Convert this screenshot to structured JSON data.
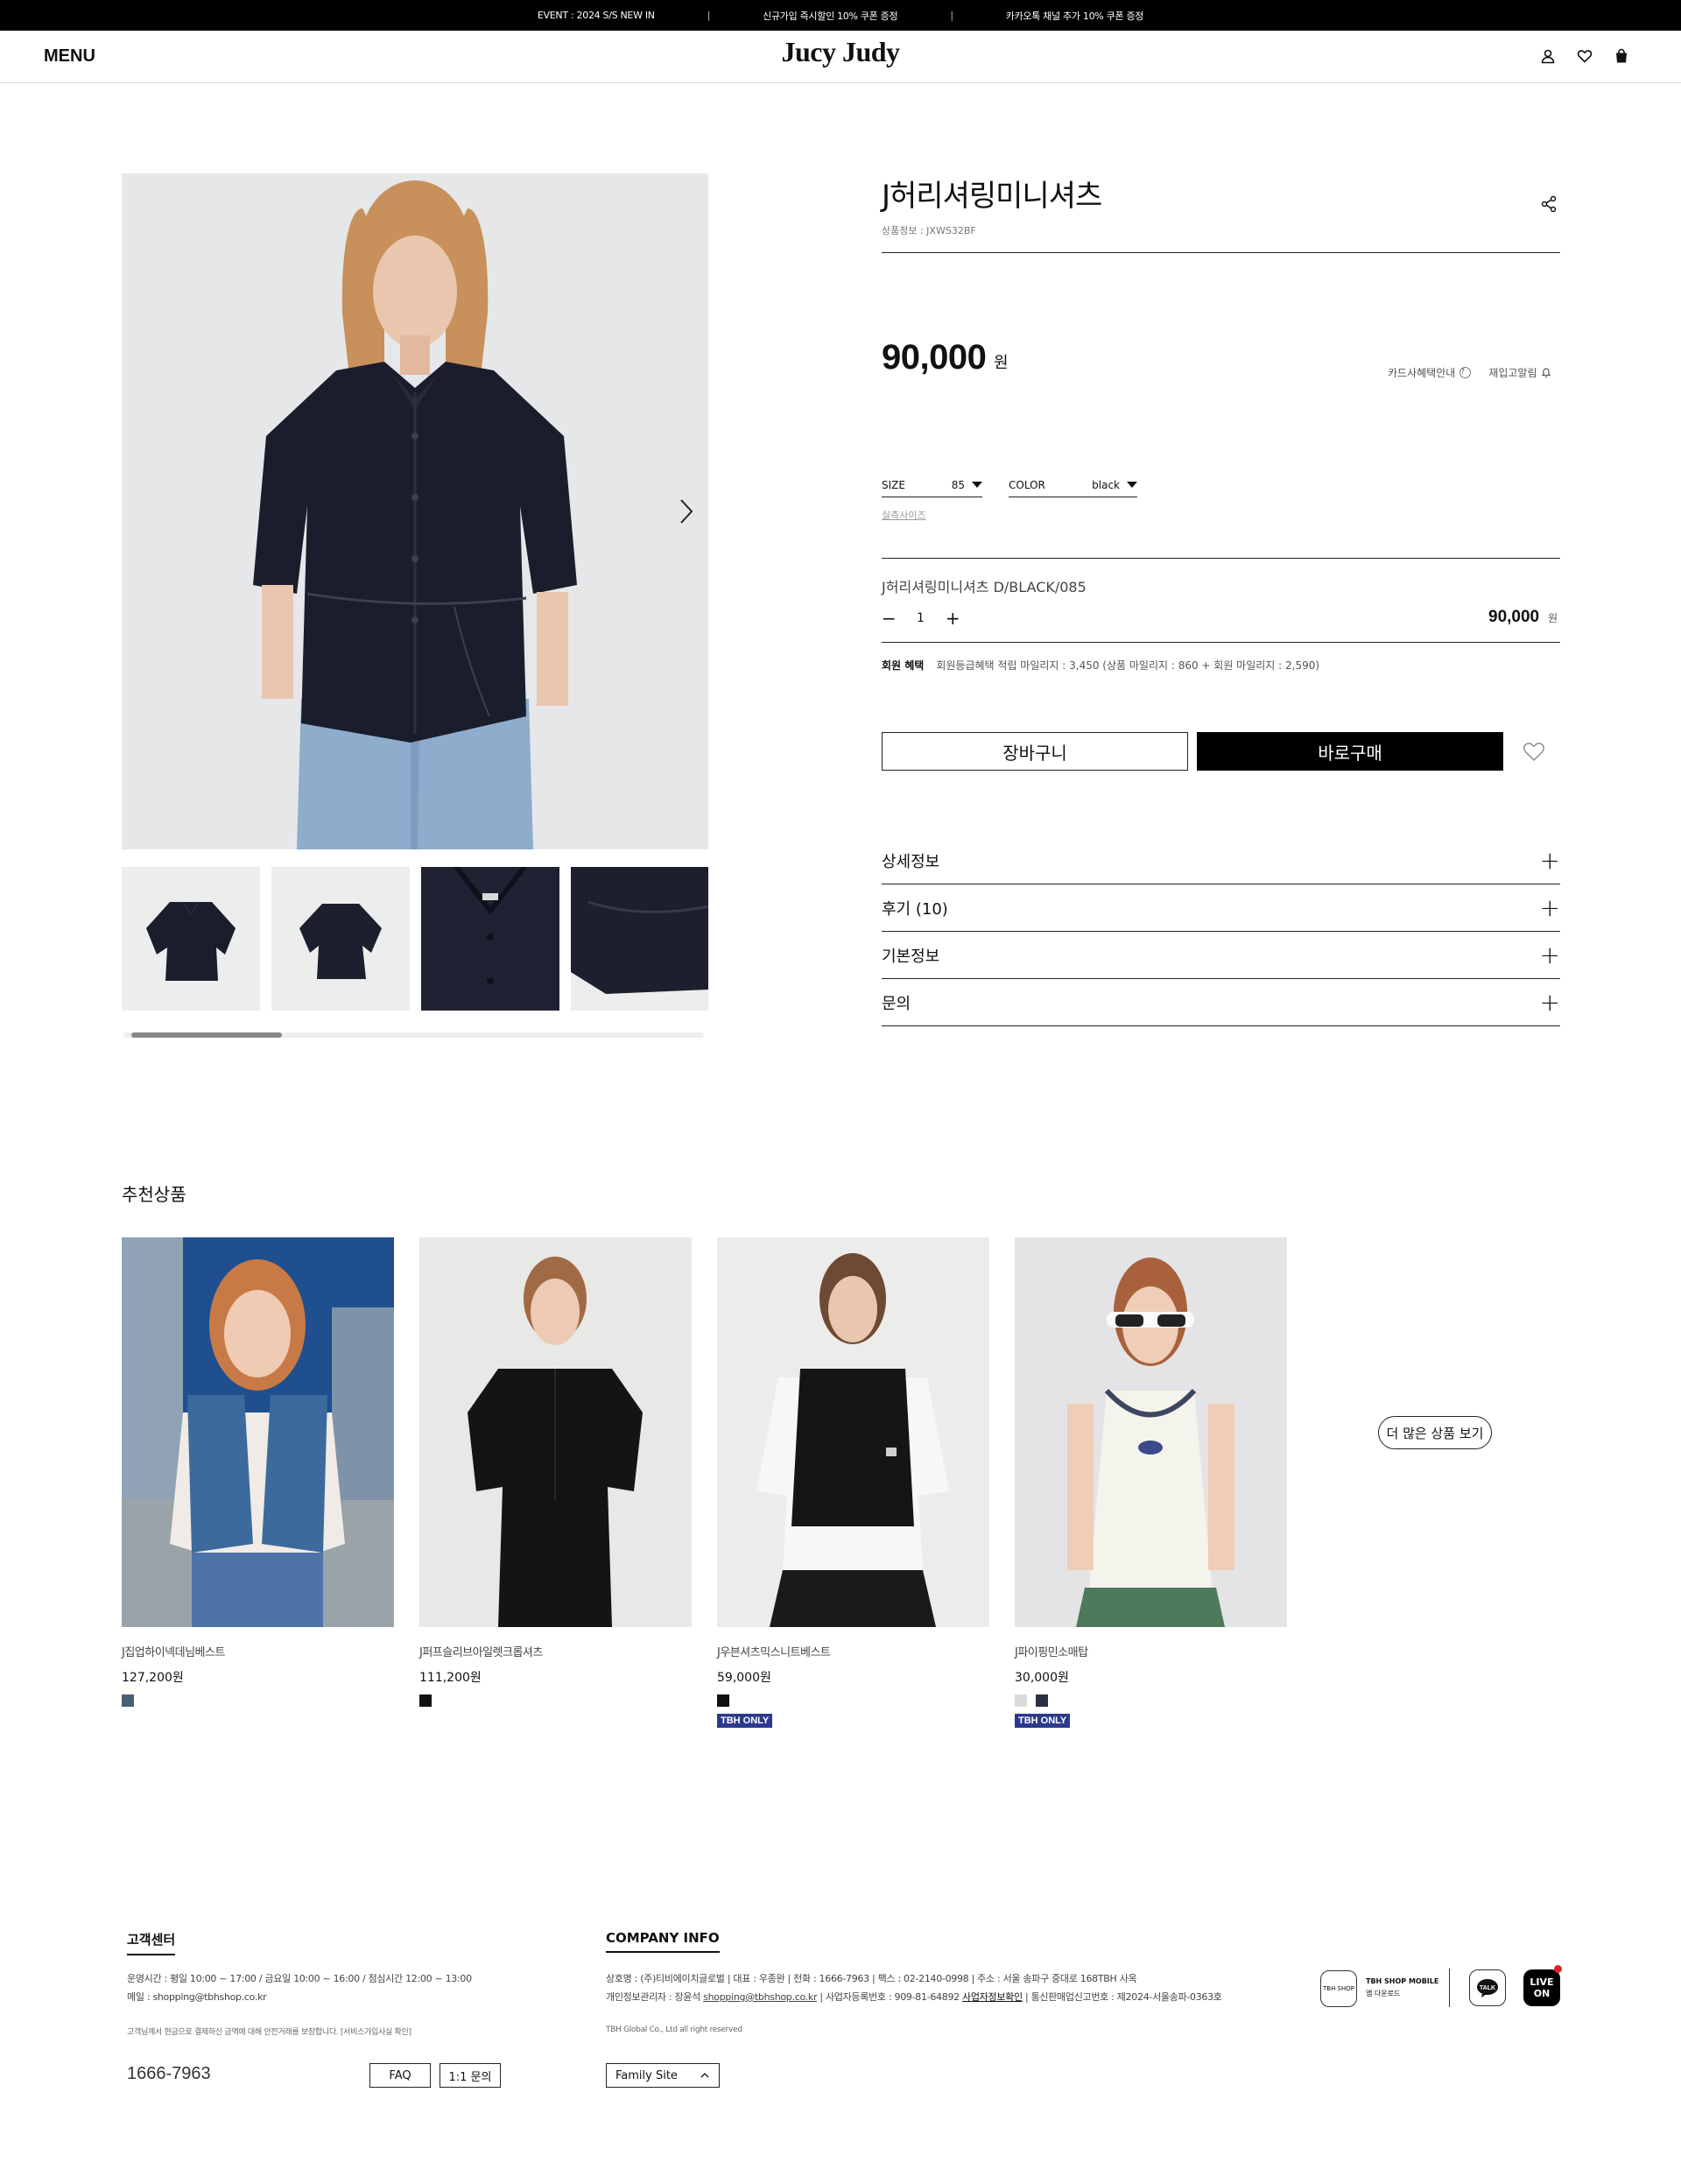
{
  "topbar": {
    "items": [
      "EVENT : 2024 S/S NEW IN",
      "신규가입 즉시할인 10% 쿠폰 증정",
      "카카오톡 채널 추가 10% 쿠폰 증정"
    ],
    "separator": "|"
  },
  "header": {
    "menu_label": "MENU",
    "logo": "Jucy Judy",
    "icons": [
      "user-icon",
      "heart-icon",
      "shopping-bag-icon"
    ]
  },
  "product": {
    "name": "J허리셔링미니셔츠",
    "code": "상품정보 : JXWS32BF",
    "price": "90,000",
    "price_unit": "원",
    "card_info_label": "카드사혜택안내",
    "restock_label": "재입고알림",
    "size_label": "SIZE",
    "size_value": "85",
    "color_label": "COLOR",
    "color_value": "black",
    "size_guide_label": "실측사이즈",
    "selected_item_name": "J허리셔링미니셔츠 D/BLACK/085",
    "quantity": "1",
    "selected_price": "90,000",
    "selected_price_unit": "원",
    "benefit_label": "회원 혜택",
    "benefit_text": "회원등급혜택 적립 마일리지 : 3,450 (상품 마일리지 : 860 + 회원 마일리지 : 2,590)",
    "cart_label": "장바구니",
    "buy_label": "바로구매",
    "accordion": [
      {
        "label": "상세정보"
      },
      {
        "label": "후기 (10)"
      },
      {
        "label": "기본정보"
      },
      {
        "label": "문의"
      }
    ],
    "colors": {
      "image_bg": "#e6e7e9",
      "shirt": "#1a1d2b"
    }
  },
  "gallery": {
    "scroll_fraction": 0.26
  },
  "recommended": {
    "title": "추천상품",
    "more_label": "더 많은 상품 보기",
    "items": [
      {
        "name": "J집업하이넥데님베스트",
        "price": "127,200원",
        "swatches": [
          "#4a6077"
        ],
        "badge": ""
      },
      {
        "name": "J퍼프슬리브아일렛크롭셔츠",
        "price": "111,200원",
        "swatches": [
          "#111111"
        ],
        "badge": ""
      },
      {
        "name": "J우븐셔츠믹스니트베스트",
        "price": "59,000원",
        "swatches": [
          "#111111"
        ],
        "badge": "TBH ONLY"
      },
      {
        "name": "J파이핑민소매탑",
        "price": "30,000원",
        "swatches": [
          "#d9dcd6",
          "#2a3142"
        ],
        "badge": "TBH ONLY"
      }
    ]
  },
  "footer": {
    "cs_title": "고객센터",
    "cs_hours": "운영시간 : 평일 10:00 ~ 17:00 / 금요일 10:00 ~ 16:00 / 점심시간 12:00 ~ 13:00",
    "cs_email": "메일 : shopping@tbhshop.co.kr",
    "cs_note": "고객님께서 현금으로 결제하신 금액에 대해 안전거래를 보장합니다. [서비스가입사실 확인]",
    "phone": "1666-7963",
    "faq_label": "FAQ",
    "qna_label": "1:1 문의",
    "company_title": "COMPANY INFO",
    "company_line1": "상호명 : (주)티비에이치글로벌  |  대표 : 우종완  |  전화 : 1666-7963  |  팩스 : 02-2140-0998  |  주소 : 서울 송파구 중대로 168TBH 사옥",
    "company_line2_prefix": "개인정보관리자 : 장윤석",
    "company_line2_email": "shopping@tbhshop.co.kr",
    "company_line2_mid": "  |  사업자등록번호 : 909-81-64892",
    "company_line2_link": "사업자정보확인",
    "company_line2_suffix": "  |  통신판매업신고번호 : 제2024-서울송파-0363호",
    "copyright": "TBH Global Co., Ltd all right reserved",
    "family_site_label": "Family Site",
    "tbh_badge": "TBH SHOP",
    "tbh_mobile_title": "TBH SHOP MOBILE",
    "tbh_mobile_sub": "앱 다운로드",
    "talk_label": "TALK",
    "live_label_1": "LIVE",
    "live_label_2": "ON"
  }
}
